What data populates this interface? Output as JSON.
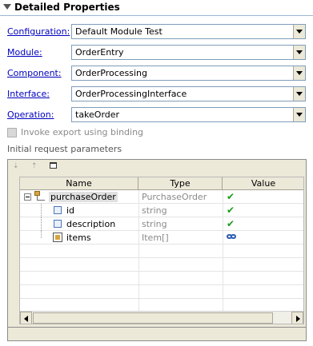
{
  "section": {
    "title": "Detailed Properties"
  },
  "fields": [
    {
      "label": "Configuration:",
      "value": "Default Module Test"
    },
    {
      "label": "Module:",
      "value": "OrderEntry"
    },
    {
      "label": "Component:",
      "value": "OrderProcessing"
    },
    {
      "label": "Interface:",
      "value": "OrderProcessingInterface"
    },
    {
      "label": "Operation:",
      "value": "takeOrder"
    }
  ],
  "invoke_export": {
    "label": "Invoke export using binding",
    "checked": false
  },
  "params_label": "Initial request parameters",
  "table": {
    "columns": [
      "Name",
      "Type",
      "Value"
    ],
    "rows": [
      {
        "name": "purchaseOrder",
        "type": "PurchaseOrder",
        "value": "✔",
        "value_icon": "check-icon"
      },
      {
        "name": "id",
        "type": "string",
        "value": "✔",
        "value_icon": "check-icon"
      },
      {
        "name": "description",
        "type": "string",
        "value": "✔",
        "value_icon": "check-icon"
      },
      {
        "name": "items",
        "type": "Item[]",
        "value": "",
        "value_icon": "link-icon"
      }
    ]
  },
  "colors": {
    "link": "#0000c0",
    "check": "#1a9a1a"
  }
}
